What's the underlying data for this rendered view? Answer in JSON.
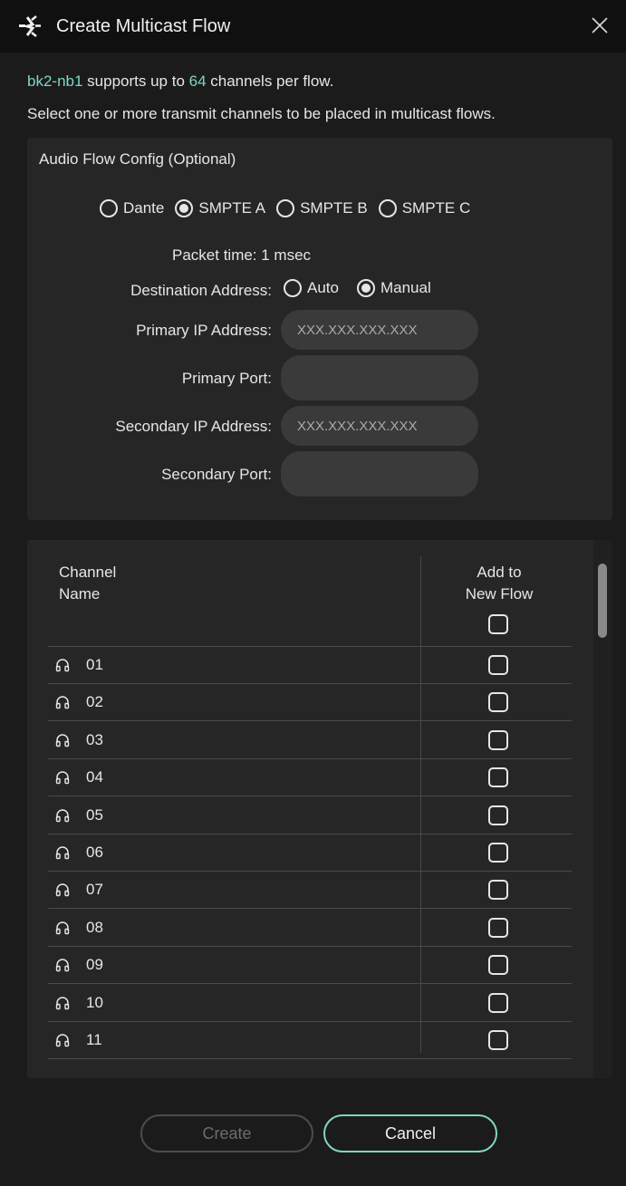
{
  "dialog": {
    "title": "Create Multicast Flow"
  },
  "info": {
    "device": "bk2-nb1",
    "supports_prefix": " supports up to ",
    "channel_limit": "64",
    "supports_suffix": " channels per flow.",
    "instruction": "Select one or more transmit channels to be placed in multicast flows."
  },
  "config": {
    "title": "Audio Flow Config (Optional)",
    "flow_types": [
      {
        "label": "Dante",
        "checked": false
      },
      {
        "label": "SMPTE A",
        "checked": true
      },
      {
        "label": "SMPTE B",
        "checked": false
      },
      {
        "label": "SMPTE C",
        "checked": false
      }
    ],
    "packet_time": "Packet time: 1 msec",
    "destination_label": "Destination Address:",
    "destination_options": [
      {
        "label": "Auto",
        "checked": false
      },
      {
        "label": "Manual",
        "checked": true
      }
    ],
    "primary_ip_label": "Primary IP Address:",
    "primary_ip_placeholder": "XXX.XXX.XXX.XXX",
    "primary_port_label": "Primary Port:",
    "secondary_ip_label": "Secondary IP Address:",
    "secondary_ip_placeholder": "XXX.XXX.XXX.XXX",
    "secondary_port_label": "Secondary Port:"
  },
  "table": {
    "header_channel_line1": "Channel",
    "header_channel_line2": "Name",
    "header_add_line1": "Add to",
    "header_add_line2": "New Flow",
    "rows": [
      "01",
      "02",
      "03",
      "04",
      "05",
      "06",
      "07",
      "08",
      "09",
      "10",
      "11"
    ]
  },
  "buttons": {
    "create": "Create",
    "cancel": "Cancel"
  },
  "colors": {
    "accent": "#7fd6c4",
    "background": "#1b1b1b",
    "panel": "#262626"
  },
  "icons": {
    "logo": "dante-logo-icon",
    "close": "close-icon",
    "channel": "headphones-icon"
  }
}
